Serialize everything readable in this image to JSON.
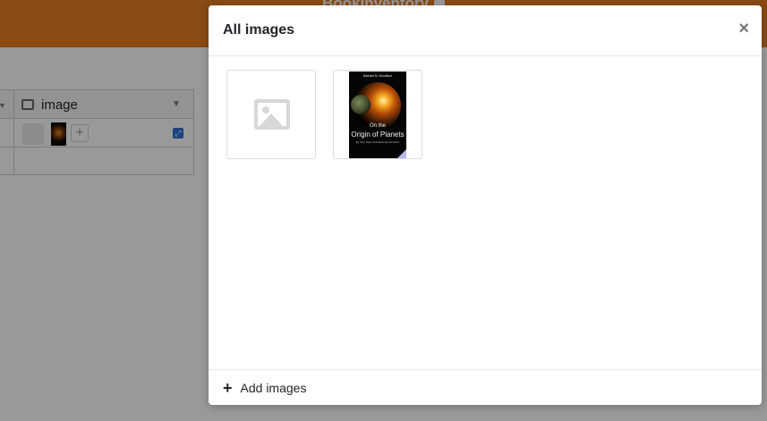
{
  "app": {
    "title": "BookInventory"
  },
  "grid": {
    "column_name": "image"
  },
  "modal": {
    "title": "All images",
    "close_symbol": "×",
    "images": [
      {
        "kind": "placeholder",
        "icon": "image-placeholder-icon"
      },
      {
        "kind": "book-cover",
        "cover_author": "Michael M. Woolfson",
        "cover_title_line1": "On the",
        "cover_title_line2": "Origin of Planets",
        "cover_subtitle": "By Very Slow Gravitational Accretion"
      }
    ],
    "footer": {
      "add_symbol": "+",
      "add_label": "Add images"
    }
  },
  "colors": {
    "header": "#e67e22",
    "overlay": "rgba(0,0,0,0.40)",
    "accent": "#2f6fd6"
  }
}
